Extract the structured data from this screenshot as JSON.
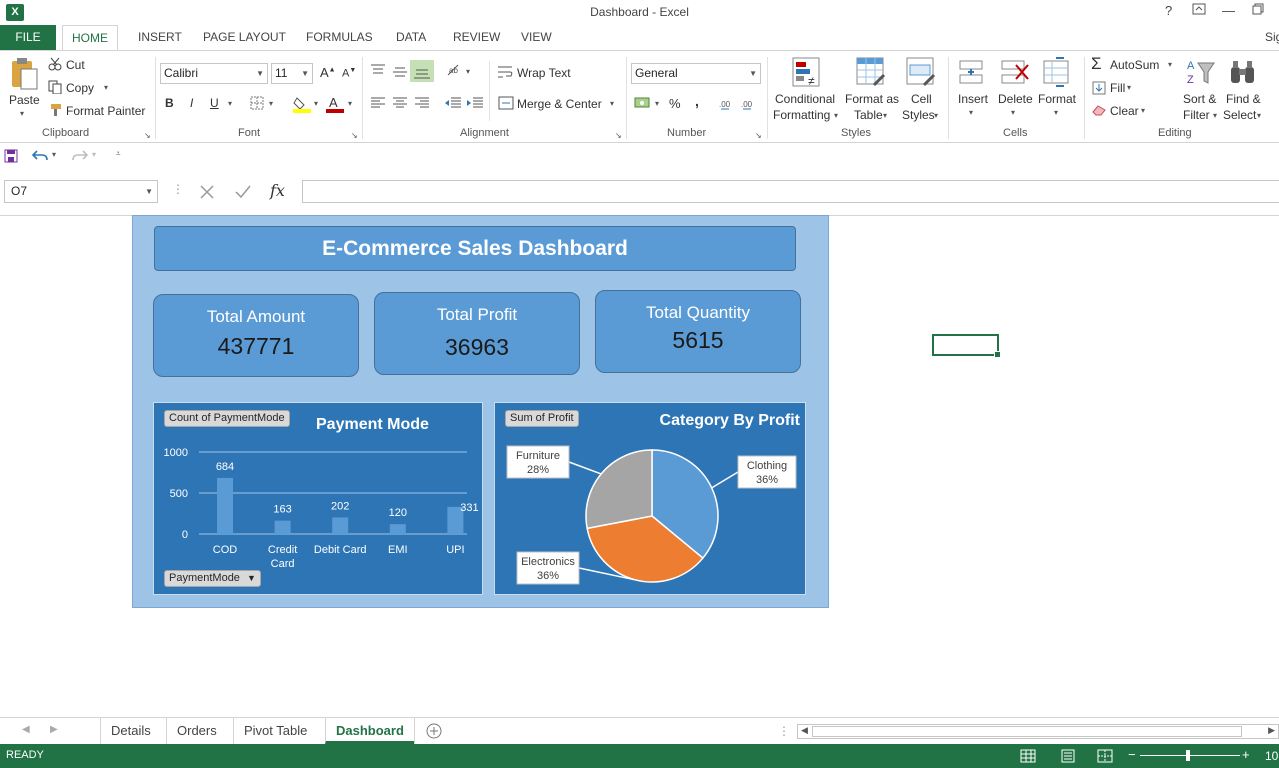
{
  "window": {
    "title": "Dashboard - Excel",
    "help": "?",
    "sign_in": "Sig"
  },
  "ribbon_tabs": [
    "FILE",
    "HOME",
    "INSERT",
    "PAGE LAYOUT",
    "FORMULAS",
    "DATA",
    "REVIEW",
    "VIEW"
  ],
  "clipboard": {
    "paste": "Paste",
    "cut": "Cut",
    "copy": "Copy",
    "format_painter": "Format Painter",
    "label": "Clipboard"
  },
  "font": {
    "name": "Calibri",
    "size": "11",
    "bold": "B",
    "italic": "I",
    "underline": "U",
    "label": "Font"
  },
  "alignment": {
    "wrap": "Wrap Text",
    "merge": "Merge & Center",
    "label": "Alignment"
  },
  "number": {
    "format": "General",
    "percent": "%",
    "comma": ",",
    "label": "Number"
  },
  "styles": {
    "conditional": [
      "Conditional",
      "Formatting"
    ],
    "format_table": [
      "Format as",
      "Table"
    ],
    "cell_styles": [
      "Cell",
      "Styles"
    ],
    "label": "Styles"
  },
  "cells": {
    "insert": "Insert",
    "delete": "Delete",
    "format": "Format",
    "label": "Cells"
  },
  "editing": {
    "autosum": "AutoSum",
    "fill": "Fill",
    "clear": "Clear",
    "sort": [
      "Sort &",
      "Filter"
    ],
    "find": [
      "Find &",
      "Select"
    ],
    "label": "Editing"
  },
  "formula_bar": {
    "name_box": "O7",
    "fx": "fx",
    "formula": ""
  },
  "dashboard": {
    "title": "E-Commerce Sales Dashboard",
    "kpis": [
      {
        "label": "Total Amount",
        "value": "437771"
      },
      {
        "label": "Total Profit",
        "value": "36963"
      },
      {
        "label": "Total Quantity",
        "value": "5615"
      }
    ]
  },
  "chart_data": [
    {
      "type": "bar",
      "title": "Payment Mode",
      "field_button": "Count of PaymentMode",
      "axis_field_button": "PaymentMode",
      "categories": [
        "COD",
        "Credit Card",
        "Debit Card",
        "EMI",
        "UPI"
      ],
      "category_labels": [
        [
          "COD"
        ],
        [
          "Credit",
          "Card"
        ],
        [
          "Debit Card"
        ],
        [
          "EMI"
        ],
        [
          "UPI"
        ]
      ],
      "values": [
        684,
        163,
        202,
        120,
        331
      ],
      "yticks": [
        0,
        500,
        1000
      ],
      "ylim": [
        0,
        1000
      ],
      "grid": true,
      "colors": {
        "bar": "#5b9bd5",
        "background": "#2e75b6"
      }
    },
    {
      "type": "pie",
      "title": "Category By Profit",
      "field_button": "Sum of Profit",
      "slices": [
        {
          "label": "Clothing",
          "pct": "36%",
          "value": 36,
          "color": "#5b9bd5"
        },
        {
          "label": "Electronics",
          "pct": "36%",
          "value": 36,
          "color": "#ed7d31"
        },
        {
          "label": "Furniture",
          "pct": "28%",
          "value": 28,
          "color": "#a5a5a5"
        }
      ]
    }
  ],
  "sheet_tabs": [
    {
      "name": "Details",
      "active": false
    },
    {
      "name": "Orders",
      "active": false
    },
    {
      "name": "Pivot Table",
      "active": false
    },
    {
      "name": "Dashboard",
      "active": true
    }
  ],
  "status": {
    "mode": "READY",
    "zoom": "10"
  }
}
